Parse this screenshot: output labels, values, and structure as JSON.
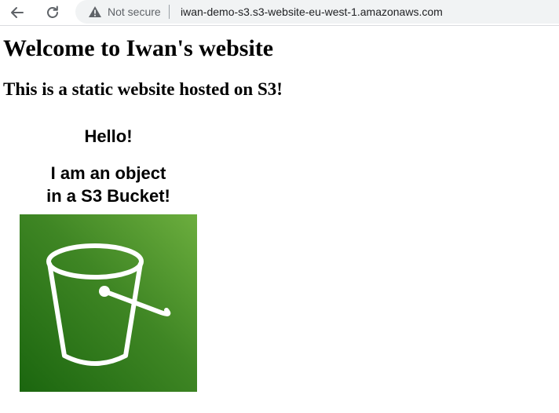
{
  "browser": {
    "security_label": "Not secure",
    "url": "iwan-demo-s3.s3-website-eu-west-1.amazonaws.com"
  },
  "page": {
    "heading": "Welcome to Iwan's website",
    "subheading": "This is a static website hosted on S3!",
    "hello": "Hello!",
    "object_line1": "I am an object",
    "object_line2": "in a S3 Bucket!"
  },
  "image": {
    "icon": "s3-bucket-icon",
    "colors": {
      "dark_green": "#1b660f",
      "mid_green": "#3f8624",
      "light_green": "#6cae3e"
    }
  }
}
